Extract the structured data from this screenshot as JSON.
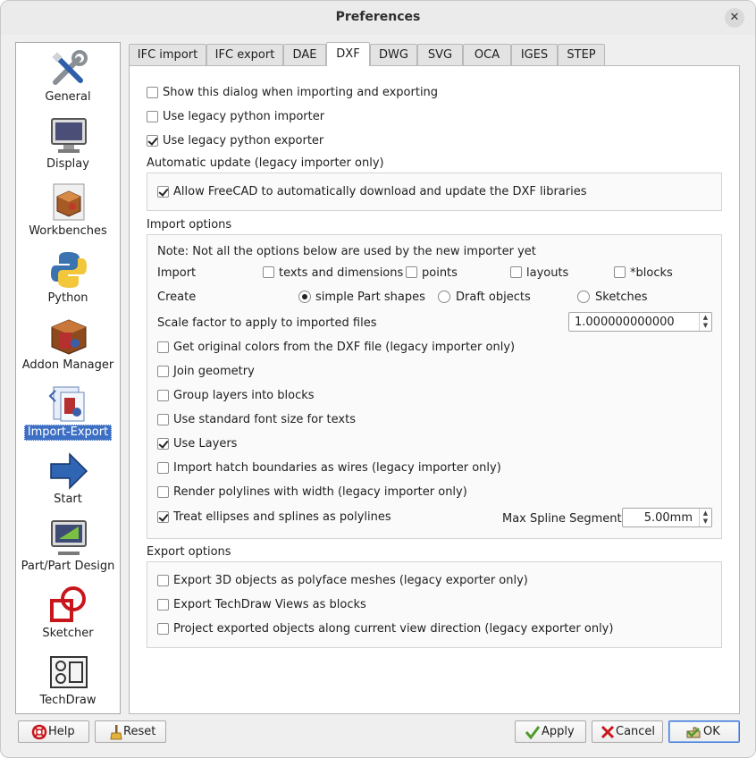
{
  "window": {
    "title": "Preferences",
    "close_glyph": "✕"
  },
  "sidebar": {
    "items": [
      {
        "label": "General",
        "icon": "tools-icon"
      },
      {
        "label": "Display",
        "icon": "monitor-icon"
      },
      {
        "label": "Workbenches",
        "icon": "workbench-box-icon"
      },
      {
        "label": "Python",
        "icon": "python-icon"
      },
      {
        "label": "Addon Manager",
        "icon": "addon-box-icon"
      },
      {
        "label": "Import-Export",
        "icon": "import-export-icon",
        "selected": true
      },
      {
        "label": "Start",
        "icon": "arrow-right-icon"
      },
      {
        "label": "Part/Part Design",
        "icon": "part-design-icon"
      },
      {
        "label": "Sketcher",
        "icon": "sketcher-icon"
      },
      {
        "label": "TechDraw",
        "icon": "techdraw-icon"
      }
    ]
  },
  "tabs": [
    {
      "label": "IFC import"
    },
    {
      "label": "IFC export"
    },
    {
      "label": "DAE"
    },
    {
      "label": "DXF",
      "active": true
    },
    {
      "label": "DWG"
    },
    {
      "label": "SVG"
    },
    {
      "label": "OCA"
    },
    {
      "label": "IGES"
    },
    {
      "label": "STEP"
    }
  ],
  "dxf": {
    "general": [
      {
        "label": "Show this dialog when importing and exporting",
        "checked": false
      },
      {
        "label": "Use legacy python importer",
        "checked": false
      },
      {
        "label": "Use legacy python exporter",
        "checked": true
      }
    ],
    "auto_update": {
      "heading": "Automatic update (legacy importer only)",
      "option": {
        "label": "Allow FreeCAD to automatically download and update the DXF libraries",
        "checked": true
      }
    },
    "import": {
      "heading": "Import options",
      "note": "Note: Not all the options below are used by the new importer yet",
      "import_label": "Import",
      "import_checks": [
        {
          "label": "texts and dimensions",
          "checked": false
        },
        {
          "label": "points",
          "checked": false
        },
        {
          "label": "layouts",
          "checked": false
        },
        {
          "label": "*blocks",
          "checked": false
        }
      ],
      "create_label": "Create",
      "create_radios": [
        {
          "label": "simple Part shapes",
          "checked": true
        },
        {
          "label": "Draft objects",
          "checked": false
        },
        {
          "label": "Sketches",
          "checked": false
        }
      ],
      "scale_label": "Scale factor to apply to imported files",
      "scale_value": "1.000000000000",
      "options": [
        {
          "label": "Get original colors from the DXF file (legacy importer only)",
          "checked": false
        },
        {
          "label": "Join geometry",
          "checked": false
        },
        {
          "label": "Group layers into blocks",
          "checked": false
        },
        {
          "label": "Use standard font size for texts",
          "checked": false
        },
        {
          "label": "Use Layers",
          "checked": true
        },
        {
          "label": "Import hatch boundaries as wires (legacy importer only)",
          "checked": false
        },
        {
          "label": "Render polylines with width (legacy importer only)",
          "checked": false
        },
        {
          "label": "Treat ellipses and splines as polylines",
          "checked": true
        }
      ],
      "max_spline_label": "Max Spline Segment:",
      "max_spline_value": "5.00mm"
    },
    "export": {
      "heading": "Export options",
      "options": [
        {
          "label": "Export 3D objects as polyface meshes (legacy exporter only)",
          "checked": false
        },
        {
          "label": "Export TechDraw Views as blocks",
          "checked": false
        },
        {
          "label": "Project exported objects along current view direction (legacy exporter only)",
          "checked": false
        }
      ]
    }
  },
  "buttons": {
    "help": "Help",
    "reset": "Reset",
    "apply": "Apply",
    "cancel": "Cancel",
    "ok": "OK"
  }
}
